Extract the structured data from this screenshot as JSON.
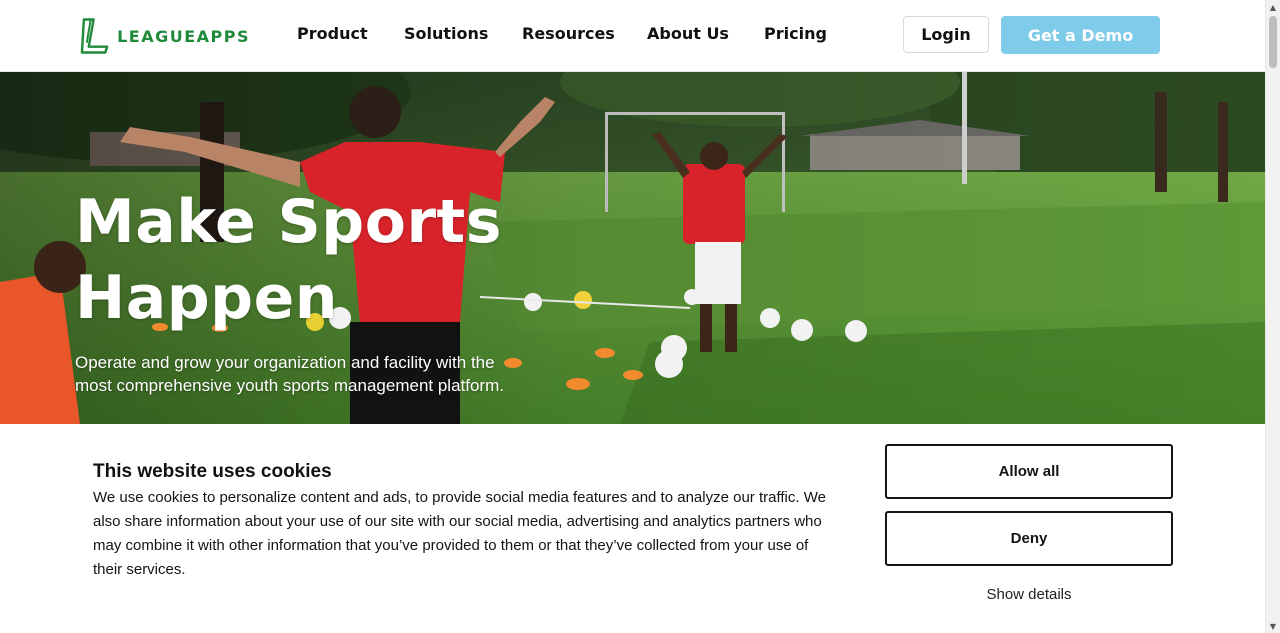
{
  "header": {
    "logo_text": "LEAGUEAPPS",
    "nav": [
      {
        "label": "Product"
      },
      {
        "label": "Solutions"
      },
      {
        "label": "Resources"
      },
      {
        "label": "About Us"
      },
      {
        "label": "Pricing"
      }
    ],
    "login_label": "Login",
    "demo_label": "Get a Demo"
  },
  "hero": {
    "title_line1": "Make Sports",
    "title_line2": "Happen",
    "subtitle": "Operate and grow your organization and facility with the most comprehensive youth sports management platform."
  },
  "cookie_banner": {
    "title": "This website uses cookies",
    "body": "We use cookies to personalize content and ads, to provide social media features and to analyze our traffic. We also share information about your use of our site with our social media, advertising and analytics partners who may combine it with other information that you’ve provided to them or that they’ve collected from your use of their services.",
    "allow_all_label": "Allow all",
    "deny_label": "Deny",
    "show_details_label": "Show details"
  },
  "colors": {
    "brand_green": "#1f8a3a",
    "demo_button": "#7fcbea",
    "jersey_red": "#d8232a"
  },
  "icons": {
    "logo": "leagueapps-logo-icon",
    "scroll_up": "triangle-up-icon",
    "scroll_down": "triangle-down-icon"
  }
}
